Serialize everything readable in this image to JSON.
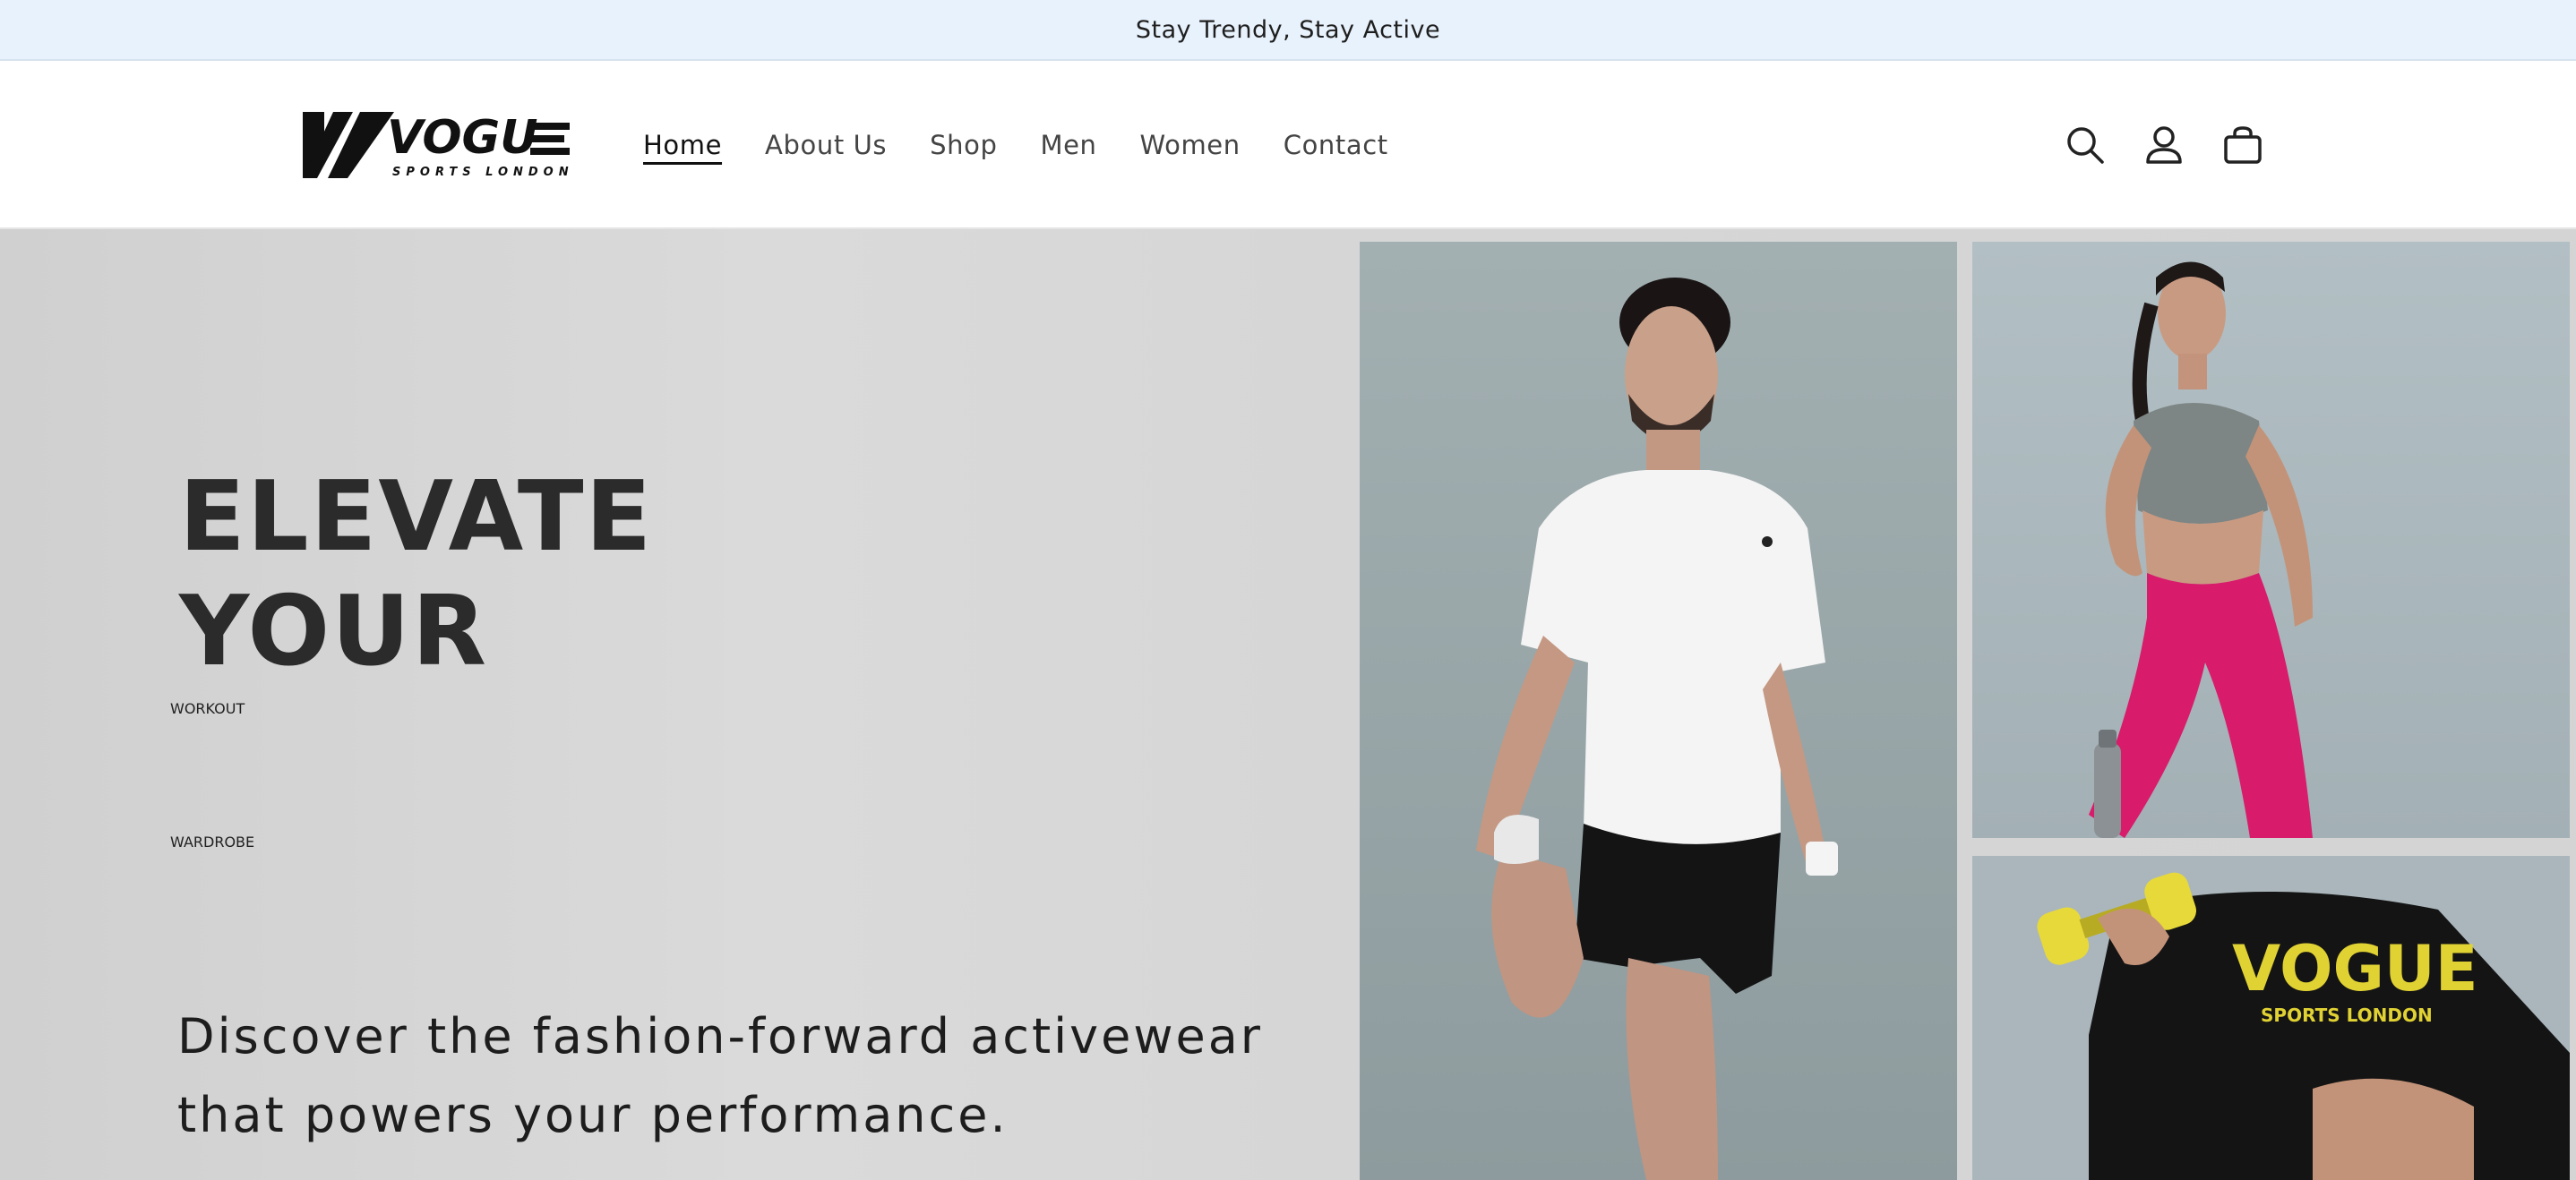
{
  "announcement": {
    "text": "Stay Trendy, Stay Active"
  },
  "header": {
    "logo": {
      "brand": "VOGUE",
      "tagline": "SPORTS LONDON"
    },
    "nav": [
      {
        "label": "Home",
        "active": true
      },
      {
        "label": "About Us",
        "active": false
      },
      {
        "label": "Shop",
        "active": false
      },
      {
        "label": "Men",
        "active": false
      },
      {
        "label": "Women",
        "active": false
      },
      {
        "label": "Contact",
        "active": false
      }
    ],
    "icons": [
      "search-icon",
      "account-icon",
      "cart-icon"
    ]
  },
  "hero": {
    "line1": "ELEVATE",
    "line2": "YOUR",
    "highlight1": "WORKOUT",
    "highlight2": "WARDROBE",
    "subtext": "Discover the fashion-forward activewear that powers your performance."
  },
  "photos": {
    "shirt_print_brand": "VOGUE",
    "shirt_print_tagline": "SPORTS LONDON"
  },
  "colors": {
    "announcement_bg": "#e8f2fd",
    "hero_bg": "#d6d6d6",
    "highlight_bg": "#161616",
    "leggings": "#d81b6a",
    "dumbbell": "#e7d93a"
  }
}
